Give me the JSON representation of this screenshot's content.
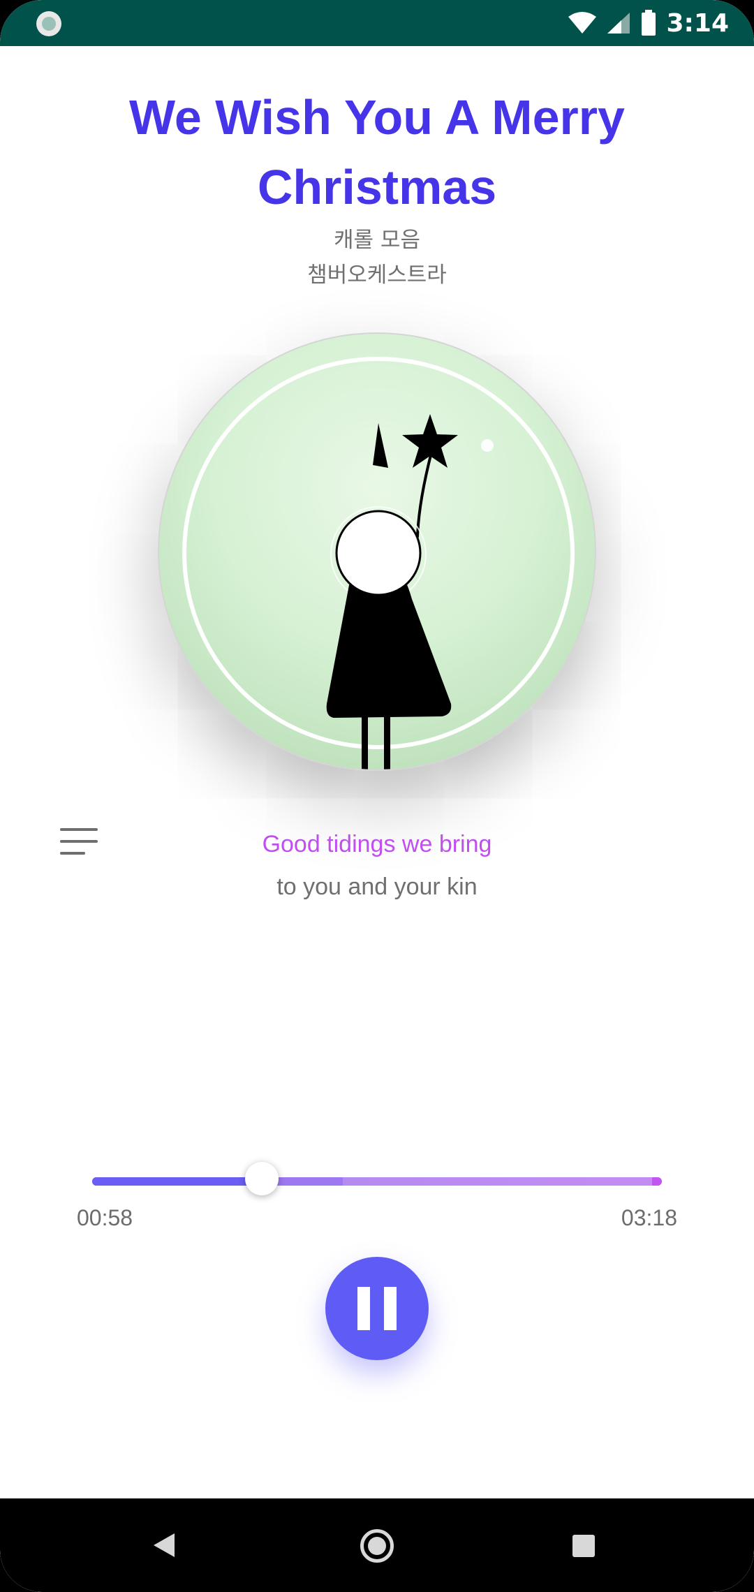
{
  "status_bar": {
    "time": "3:14",
    "icons": [
      "app-notification-icon",
      "wifi-icon",
      "cell-signal-icon",
      "battery-icon"
    ]
  },
  "song": {
    "title": "We Wish You A Merry Christmas",
    "album": "캐롤 모음",
    "artist": "챔버오케스트라"
  },
  "lyrics": {
    "current": "Good tidings we bring",
    "next": "to you and your kin"
  },
  "player": {
    "current_time": "00:58",
    "total_time": "03:18",
    "progress": 0.298,
    "buffered": 0.44,
    "state": "playing",
    "button_icon": "pause-icon"
  },
  "colors": {
    "accent": "#4634e8",
    "lyric_highlight": "#c14ff0",
    "play_button": "#5f5cf5",
    "status_bar": "#00524a"
  },
  "nav_bar": {
    "icons": [
      "back-icon",
      "home-icon",
      "recents-icon"
    ]
  }
}
